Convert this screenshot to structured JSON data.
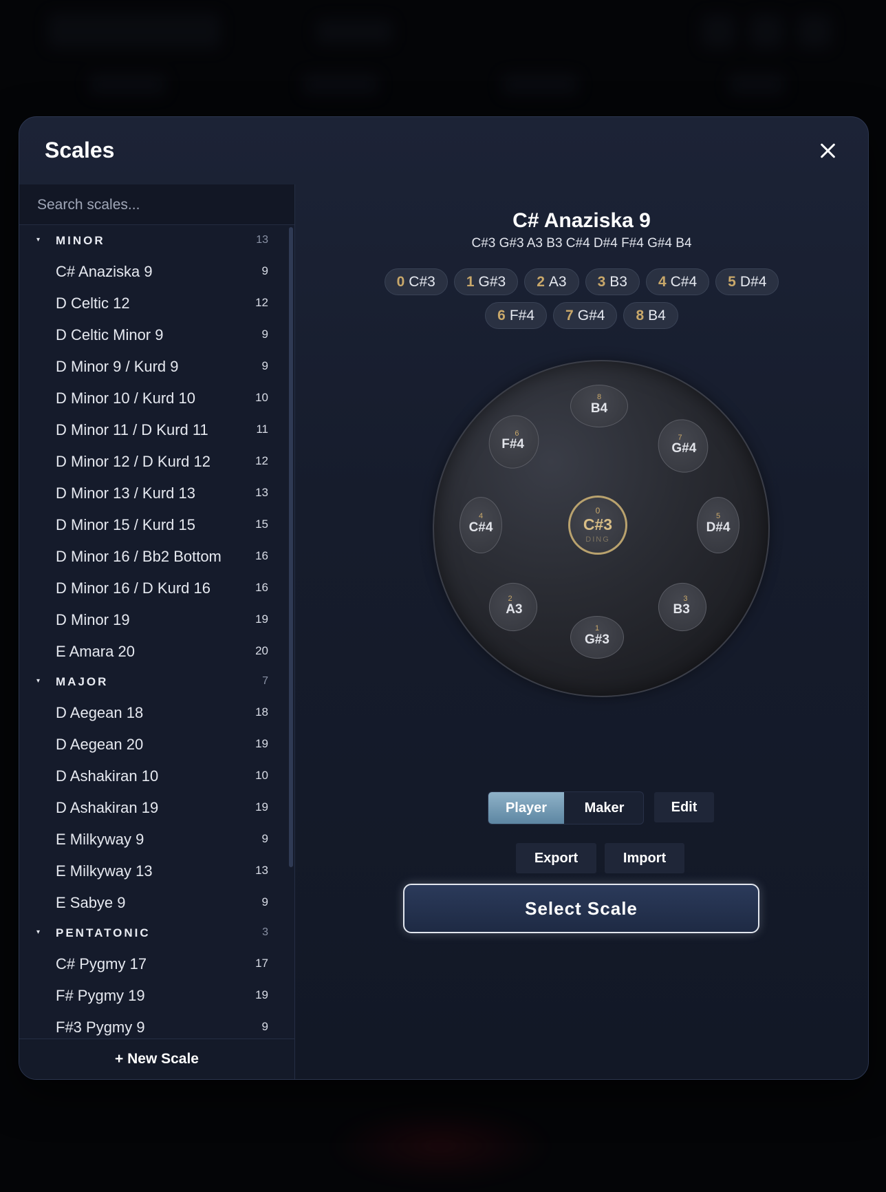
{
  "modal": {
    "title": "Scales"
  },
  "search": {
    "placeholder": "Search scales..."
  },
  "groups": [
    {
      "name": "MINOR",
      "count": "13",
      "items": [
        {
          "name": "C# Anaziska 9",
          "count": "9"
        },
        {
          "name": "D Celtic 12",
          "count": "12"
        },
        {
          "name": "D Celtic Minor 9",
          "count": "9"
        },
        {
          "name": "D Minor 9 / Kurd 9",
          "count": "9"
        },
        {
          "name": "D Minor 10 / Kurd 10",
          "count": "10"
        },
        {
          "name": "D Minor 11 / D Kurd 11",
          "count": "11"
        },
        {
          "name": "D Minor 12 / D Kurd 12",
          "count": "12"
        },
        {
          "name": "D Minor 13 / Kurd 13",
          "count": "13"
        },
        {
          "name": "D Minor 15 / Kurd 15",
          "count": "15"
        },
        {
          "name": "D Minor 16 / Bb2 Bottom",
          "count": "16"
        },
        {
          "name": "D Minor 16 / D Kurd 16",
          "count": "16"
        },
        {
          "name": "D Minor 19",
          "count": "19"
        },
        {
          "name": "E Amara 20",
          "count": "20"
        }
      ]
    },
    {
      "name": "MAJOR",
      "count": "7",
      "items": [
        {
          "name": "D Aegean 18",
          "count": "18"
        },
        {
          "name": "D Aegean 20",
          "count": "19"
        },
        {
          "name": "D Ashakiran 10",
          "count": "10"
        },
        {
          "name": "D Ashakiran 19",
          "count": "19"
        },
        {
          "name": "E Milkyway 9",
          "count": "9"
        },
        {
          "name": "E Milkyway 13",
          "count": "13"
        },
        {
          "name": "E Sabye 9",
          "count": "9"
        }
      ]
    },
    {
      "name": "PENTATONIC",
      "count": "3",
      "items": [
        {
          "name": "C# Pygmy 17",
          "count": "17"
        },
        {
          "name": "F# Pygmy 19",
          "count": "19"
        },
        {
          "name": "F#3 Pygmy 9",
          "count": "9"
        }
      ]
    }
  ],
  "new_scale_label": "+ New Scale",
  "selected": {
    "name": "C# Anaziska 9",
    "notes_text": "C#3 G#3 A3 B3 C#4 D#4 F#4 G#4 B4",
    "chips": [
      {
        "idx": "0",
        "note": "C#3"
      },
      {
        "idx": "1",
        "note": "G#3"
      },
      {
        "idx": "2",
        "note": "A3"
      },
      {
        "idx": "3",
        "note": "B3"
      },
      {
        "idx": "4",
        "note": "C#4"
      },
      {
        "idx": "5",
        "note": "D#4"
      },
      {
        "idx": "6",
        "note": "F#4"
      },
      {
        "idx": "7",
        "note": "G#4"
      },
      {
        "idx": "8",
        "note": "B4"
      }
    ],
    "ding": {
      "idx": "0",
      "note": "C#3",
      "label": "DING"
    }
  },
  "buttons": {
    "player": "Player",
    "maker": "Maker",
    "edit": "Edit",
    "export": "Export",
    "import": "Import",
    "select": "Select Scale"
  },
  "colors": {
    "accent_gold": "#c9a86a",
    "player_active": "#7aa0b8",
    "modal_bg": "#1a2132"
  }
}
